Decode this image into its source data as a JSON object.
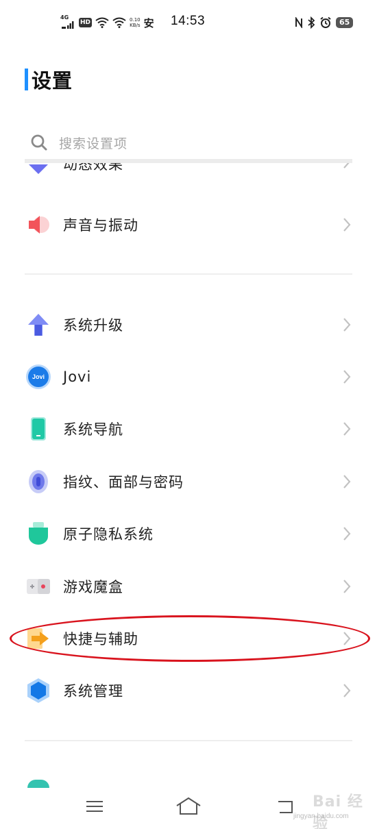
{
  "status_bar": {
    "network": "4G",
    "hd": "HD",
    "speed_value": "0.10",
    "speed_unit": "KB/s",
    "security_glyph": "安",
    "time": "14:53",
    "battery": "65",
    "icons": [
      "signal-icon",
      "wifi-icon",
      "wifi-icon",
      "nfc-icon",
      "bluetooth-icon",
      "alarm-icon"
    ]
  },
  "page": {
    "title": "设置"
  },
  "search": {
    "placeholder": "搜索设置项"
  },
  "groups": [
    {
      "items": [
        {
          "label": "动态效果",
          "icon": "motion-effects-icon"
        },
        {
          "label": "声音与振动",
          "icon": "speaker-icon"
        }
      ]
    },
    {
      "items": [
        {
          "label": "系统升级",
          "icon": "system-upgrade-icon"
        },
        {
          "label": "Jovi",
          "icon": "jovi-icon"
        },
        {
          "label": "系统导航",
          "icon": "phone-navigation-icon"
        },
        {
          "label": "指纹、面部与密码",
          "icon": "fingerprint-icon"
        },
        {
          "label": "原子隐私系统",
          "icon": "privacy-icon"
        },
        {
          "label": "游戏魔盒",
          "icon": "game-box-icon"
        },
        {
          "label": "快捷与辅助",
          "icon": "shortcut-arrow-icon"
        },
        {
          "label": "系统管理",
          "icon": "system-management-icon"
        }
      ]
    }
  ],
  "jovi_badge": "Jovi",
  "nav": {
    "icons": [
      "menu-icon",
      "home-icon",
      "back-icon"
    ]
  },
  "watermark": {
    "text": "Bai 经验",
    "sub": "jingyan.baidu.com"
  },
  "colors": {
    "accent": "#1e90ff",
    "annotation": "#d9141e"
  }
}
